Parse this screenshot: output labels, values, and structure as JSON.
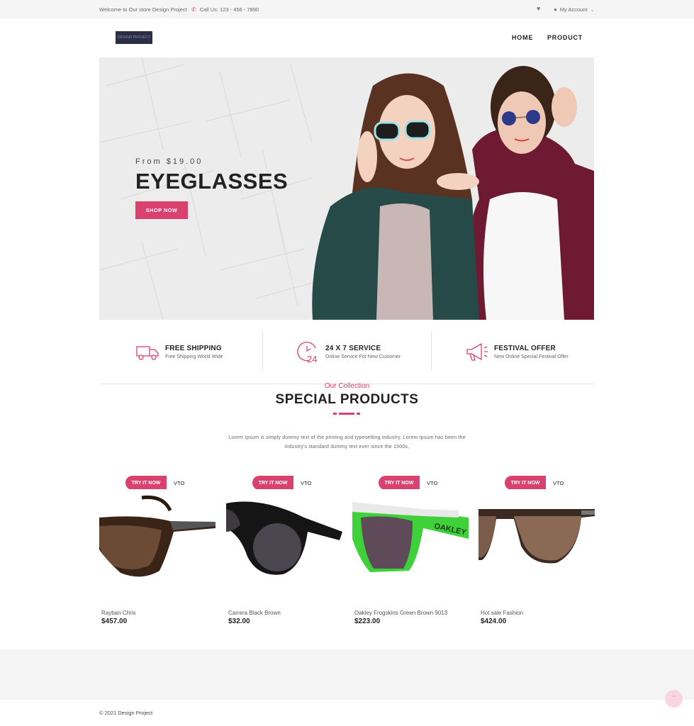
{
  "topbar": {
    "welcome": "Welcome to Our store Design Project",
    "phone": "Call Us: 123 - 456 - 7890",
    "account": "My Account",
    "phone_icon": "phone-icon",
    "heart_icon": "heart-icon",
    "user_icon": "user-icon"
  },
  "header": {
    "logo": "DESIGN PROJECT",
    "nav": [
      "HOME",
      "PRODUCT"
    ]
  },
  "hero": {
    "from": "From $19.00",
    "title": "EYEGLASSES",
    "button": "SHOP NOW"
  },
  "features": [
    {
      "title": "FREE SHIPPING",
      "subtitle": "Free Shipping World Wide",
      "icon": "truck-icon"
    },
    {
      "title": "24 X 7 SERVICE",
      "subtitle": "Online Service For New Customer",
      "icon": "clock-24-icon"
    },
    {
      "title": "FESTIVAL OFFER",
      "subtitle": "New Online Special Festival Offer",
      "icon": "megaphone-icon"
    }
  ],
  "collection": {
    "eyebrow": "Our Collection",
    "title": "SPECIAL PRODUCTS",
    "description": "Lorem Ipsum is simply dummy text of the printing and typesetting industry. Lorem Ipsum has been the industry's standard dummy text ever since the 1500s,"
  },
  "products": [
    {
      "try_label": "TRY IT NOW",
      "vto_label": "VTO",
      "name": "Rayban Chris",
      "price": "$457.00"
    },
    {
      "try_label": "TRY IT NOW",
      "vto_label": "VTO",
      "name": "Carrera Black Brown",
      "price": "$32.00"
    },
    {
      "try_label": "TRY IT NOW",
      "vto_label": "VTO",
      "name": "Oakley Frogskins Green Brown 9013",
      "price": "$223.00"
    },
    {
      "try_label": "TRY IT NOW",
      "vto_label": "VTO",
      "name": "Hot sale Fashion",
      "price": "$424.00"
    }
  ],
  "footer": {
    "copyright": "© 2021 Design Project"
  },
  "colors": {
    "accent": "#d9416f",
    "topbar_bg": "#f5f5f5",
    "hero_bg": "#ececec",
    "logo_bg": "#2b2f45"
  }
}
